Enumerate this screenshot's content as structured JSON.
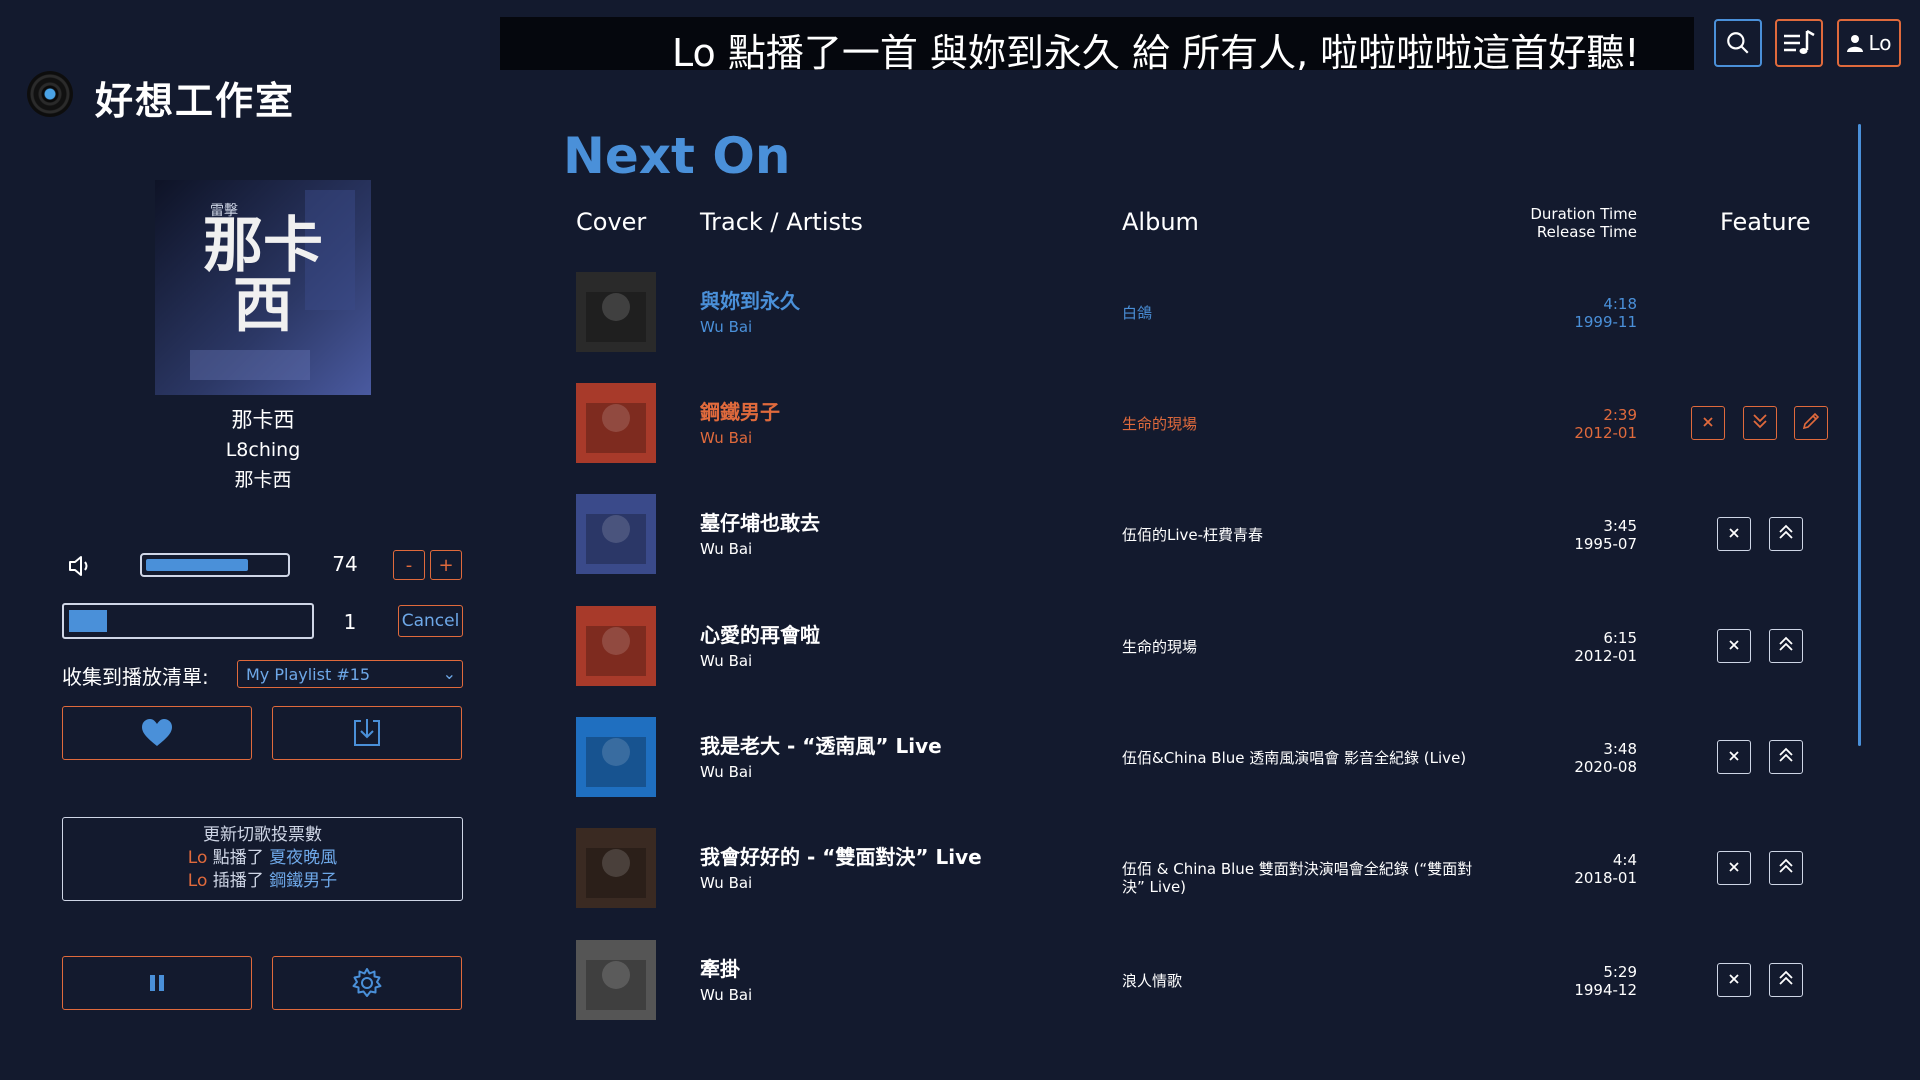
{
  "app": {
    "title": "好想工作室"
  },
  "header": {
    "marquee": "Lo 點播了一首 與妳到永久 給 所有人, 啦啦啦啦這首好聽!",
    "user_label": "Lo"
  },
  "now_playing": {
    "title": "那卡西",
    "artist": "L8ching",
    "album": "那卡西",
    "art_text": "那卡西",
    "art_small": "雷擊"
  },
  "controls": {
    "volume": 74,
    "volume_fraction": 0.74,
    "vol_minus": "-",
    "vol_plus": "+",
    "progress_fraction": 0.16,
    "progress_count": "1",
    "cancel_label": "Cancel",
    "collect_label": "收集到播放清單:",
    "playlist_selected": "My Playlist #15"
  },
  "votes": {
    "title": "更新切歌投票數",
    "lines": [
      {
        "user": "Lo",
        "verb": "點播了",
        "song": "夏夜晚風"
      },
      {
        "user": "Lo",
        "verb": "插播了",
        "song": "鋼鐵男子"
      }
    ]
  },
  "main": {
    "heading": "Next On",
    "columns": {
      "cover": "Cover",
      "track": "Track / Artists",
      "album": "Album",
      "duration": "Duration Time",
      "release": "Release Time",
      "feature": "Feature"
    }
  },
  "tracks": [
    {
      "title": "與妳到永久",
      "artist": "Wu Bai",
      "album": "白鴿",
      "duration": "4:18",
      "release": "1999-11",
      "cover_color": "#2a2a2a"
    },
    {
      "title": "鋼鐵男子",
      "artist": "Wu Bai",
      "album": "生命的現場",
      "duration": "2:39",
      "release": "2012-01",
      "cover_color": "#a83a2a"
    },
    {
      "title": "墓仔埔也敢去",
      "artist": "Wu Bai",
      "album": "伍佰的Live-枉費青春",
      "duration": "3:45",
      "release": "1995-07",
      "cover_color": "#3a4a8a"
    },
    {
      "title": "心愛的再會啦",
      "artist": "Wu Bai",
      "album": "生命的現場",
      "duration": "6:15",
      "release": "2012-01",
      "cover_color": "#a83a2a"
    },
    {
      "title": "我是老大 - “透南風” Live",
      "artist": "Wu Bai",
      "album": "伍佰&China Blue 透南風演唱會 影音全紀錄 (Live)",
      "duration": "3:48",
      "release": "2020-08",
      "cover_color": "#1f6fc0"
    },
    {
      "title": "我會好好的 - “雙面對決” Live",
      "artist": "Wu Bai",
      "album": "伍佰 & China Blue 雙面對決演唱會全紀錄 (“雙面對決” Live)",
      "duration": "4:4",
      "release": "2018-01",
      "cover_color": "#3a2a22"
    },
    {
      "title": "牽掛",
      "artist": "Wu Bai",
      "album": "浪人情歌",
      "duration": "5:29",
      "release": "1994-12",
      "cover_color": "#555555"
    }
  ],
  "colors": {
    "accent_blue": "#4a90d9",
    "accent_orange": "#e06a3c",
    "background": "#131a2e"
  }
}
